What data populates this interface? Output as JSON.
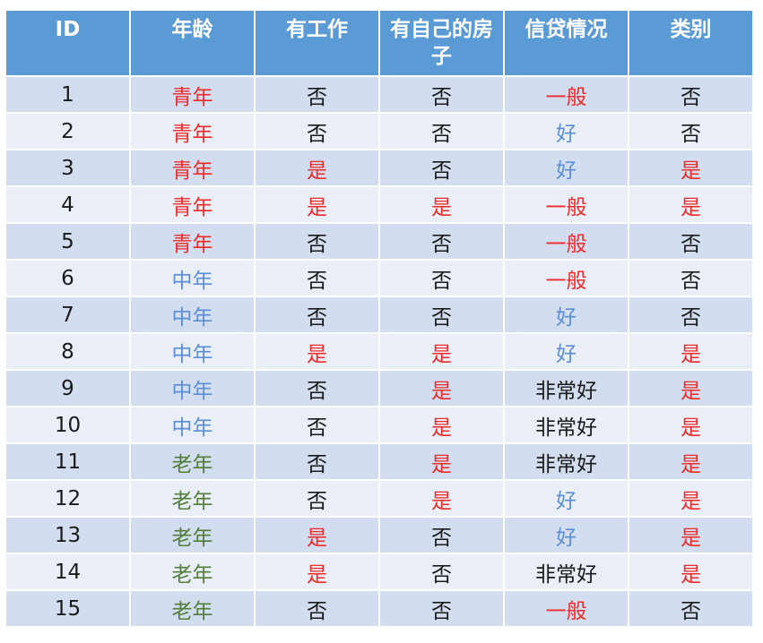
{
  "colors": {
    "header_bg": "#5b9bd5",
    "row_odd": "#d2deef",
    "row_even": "#eaeff7",
    "red": "#ee2a2a",
    "blue": "#5b8ed6",
    "green": "#507d38",
    "black": "#1a1a1a"
  },
  "table": {
    "headers": [
      "ID",
      "年龄",
      "有工作",
      "有自己的房子",
      "信贷情况",
      "类别"
    ],
    "rows": [
      [
        "1",
        "青年",
        "否",
        "否",
        "一般",
        "否"
      ],
      [
        "2",
        "青年",
        "否",
        "否",
        "好",
        "否"
      ],
      [
        "3",
        "青年",
        "是",
        "否",
        "好",
        "是"
      ],
      [
        "4",
        "青年",
        "是",
        "是",
        "一般",
        "是"
      ],
      [
        "5",
        "青年",
        "否",
        "否",
        "一般",
        "否"
      ],
      [
        "6",
        "中年",
        "否",
        "否",
        "一般",
        "否"
      ],
      [
        "7",
        "中年",
        "否",
        "否",
        "好",
        "否"
      ],
      [
        "8",
        "中年",
        "是",
        "是",
        "好",
        "是"
      ],
      [
        "9",
        "中年",
        "否",
        "是",
        "非常好",
        "是"
      ],
      [
        "10",
        "中年",
        "否",
        "是",
        "非常好",
        "是"
      ],
      [
        "11",
        "老年",
        "否",
        "是",
        "非常好",
        "是"
      ],
      [
        "12",
        "老年",
        "否",
        "是",
        "好",
        "是"
      ],
      [
        "13",
        "老年",
        "是",
        "否",
        "好",
        "是"
      ],
      [
        "14",
        "老年",
        "是",
        "否",
        "非常好",
        "是"
      ],
      [
        "15",
        "老年",
        "否",
        "否",
        "一般",
        "否"
      ]
    ]
  }
}
